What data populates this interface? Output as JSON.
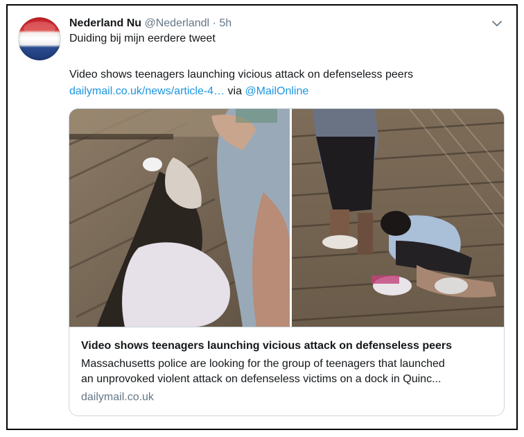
{
  "tweet": {
    "author_name": "Nederland Nu",
    "author_handle": "@Nederlandl",
    "separator": "·",
    "timestamp": "5h",
    "text_line1": "Duiding bij mijn eerdere tweet",
    "text_line2": "Video shows teenagers launching vicious attack on defenseless peers",
    "link_text": "dailymail.co.uk/news/article-4…",
    "via_text": "via",
    "mention": "@MailOnline",
    "menu_icon": "chevron-down-icon",
    "avatar_icon": "dutch-flag-avatar"
  },
  "card": {
    "title": "Video shows teenagers launching vicious attack on defenseless peers",
    "description_line1": "Massachusetts police are looking for the group of teenagers that launched",
    "description_line2": "an unprovoked violent attack on defenseless victims on a dock in Quinc...",
    "domain": "dailymail.co.uk"
  },
  "colors": {
    "link": "#1b95e0",
    "muted": "#657786",
    "text": "#14171a",
    "border": "#ccd6dd"
  }
}
